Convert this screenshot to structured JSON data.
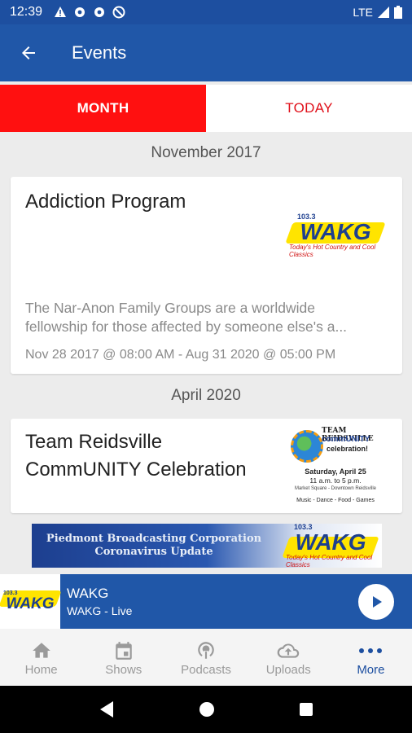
{
  "status_bar": {
    "time": "12:39",
    "network": "LTE"
  },
  "app_bar": {
    "title": "Events"
  },
  "tabs": [
    {
      "label": "MONTH",
      "active": true
    },
    {
      "label": "TODAY",
      "active": false
    }
  ],
  "sections": [
    {
      "header": "November 2017",
      "event": {
        "title": "Addiction Program",
        "description_line1": "The Nar-Anon Family Groups are a worldwide",
        "description_line2": "fellowship for those affected by someone else's a...",
        "datetime": "Nov 28 2017 @ 08:00 AM - Aug 31 2020 @ 05:00 PM"
      }
    },
    {
      "header": "April 2020",
      "event": {
        "title_line1": "Team Reidsville",
        "title_line2": "CommUNITY Celebration",
        "flyer": {
          "l1": "TEAM REIDSVILLE",
          "l2": "commUNITY",
          "l3": "celebration!",
          "date": "Saturday, April 25",
          "time": "11 a.m. to 5 p.m.",
          "place": "Market Square - Downtown Reidsville",
          "items": "Music - Dance - Food - Games"
        }
      }
    }
  ],
  "logo": {
    "freq": "103.3",
    "name": "WAKG",
    "tagline": "Today's Hot Country and Cool Classics"
  },
  "banner": {
    "line1": "Piedmont Broadcasting Corporation",
    "line2": "Coronavirus Update"
  },
  "player": {
    "title": "WAKG",
    "subtitle": "WAKG - Live"
  },
  "bottom_nav": [
    {
      "label": "Home",
      "icon": "home-icon"
    },
    {
      "label": "Shows",
      "icon": "calendar-icon"
    },
    {
      "label": "Podcasts",
      "icon": "podcast-icon"
    },
    {
      "label": "Uploads",
      "icon": "cloud-upload-icon"
    },
    {
      "label": "More",
      "icon": "more-icon",
      "active": true
    }
  ],
  "colors": {
    "primary": "#2057a8",
    "tab_active": "#ff1010",
    "logo_yellow": "#ffe400"
  }
}
